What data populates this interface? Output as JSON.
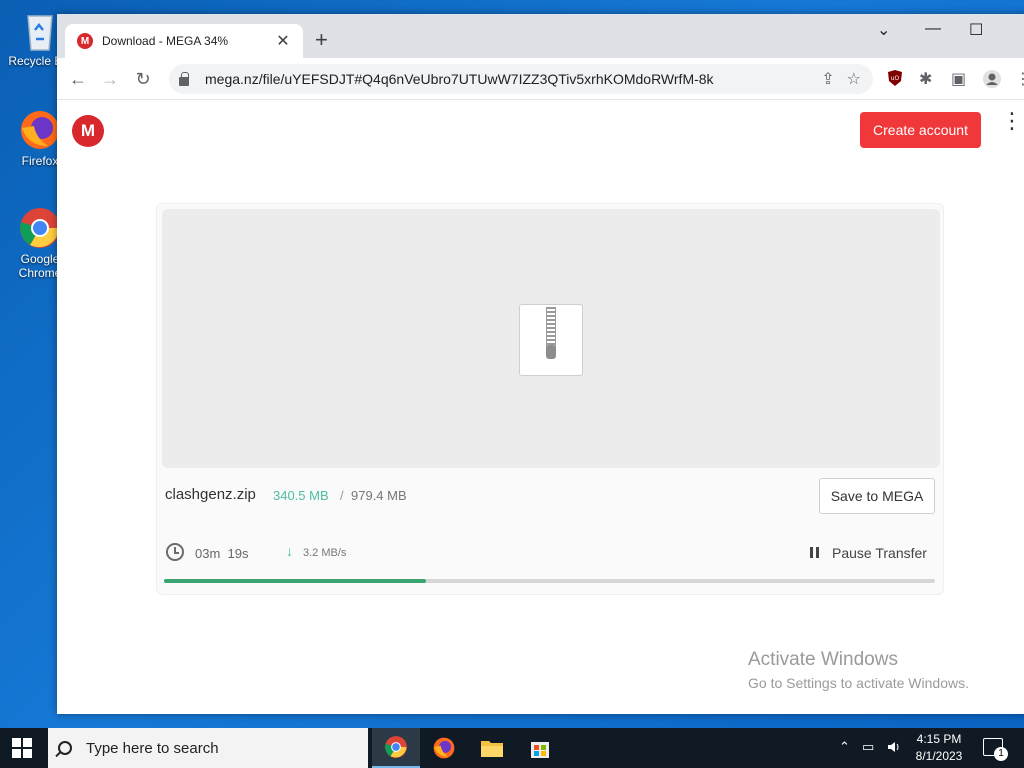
{
  "desktop": {
    "icons": [
      {
        "label": "Recycle Bin"
      },
      {
        "label": "Firefox"
      },
      {
        "label": "Google Chrome"
      }
    ]
  },
  "browser": {
    "tab_title": "Download - MEGA 34%",
    "tab_favicon": "M",
    "new_tab_symbol": "+",
    "tab_close_symbol": "✕",
    "url": "mega.nz/file/uYEFSDJT#Q4q6nVeUbro7UTUwW7IZZ3QTiv5xrhKOMdoRWrfM-8k",
    "icons": {
      "back": "←",
      "forward": "→",
      "reload": "↻",
      "share": "⇪",
      "bookmark": "☆",
      "extensions": "✱",
      "sidepanel": "▣",
      "profile": "●",
      "menu": "⋮",
      "minimize": "―",
      "maximize": "☐",
      "tabsearch": "⌄"
    }
  },
  "page": {
    "logo": "M",
    "create_account": "Create account",
    "menu": "⋮",
    "file": {
      "name": "clashgenz.zip",
      "downloaded": "340.5 MB",
      "separator": "/",
      "total": "979.4 MB",
      "save_label": "Save to MEGA",
      "time_remaining": "03m  19s",
      "speed_arrow": "↓",
      "speed": "3.2 MB/s",
      "pause_label": "Pause Transfer",
      "progress": 0.34
    },
    "watermark": {
      "title": "Activate Windows",
      "subtitle": "Go to Settings to activate Windows."
    }
  },
  "taskbar": {
    "search_placeholder": "Type here to search",
    "apps": [
      "chrome",
      "firefox",
      "file-explorer",
      "microsoft-store"
    ],
    "time": "4:15 PM",
    "date": "8/1/2023",
    "notification_count": "1",
    "tray": {
      "chevron": "⌃",
      "network": "▭",
      "volume": "🔊"
    }
  },
  "colors": {
    "mega_red": "#d9272e",
    "create_button": "#f0373a",
    "downloaded_text": "#4dbda3",
    "progress": "#3aa36e"
  }
}
